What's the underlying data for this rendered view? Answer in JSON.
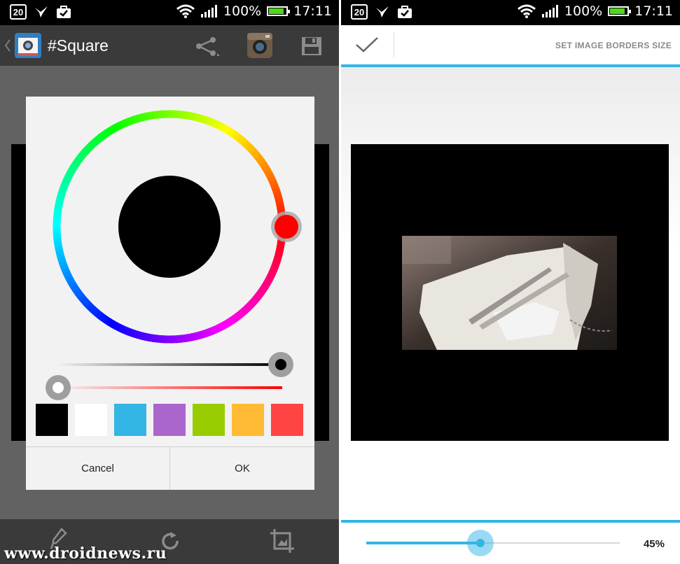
{
  "status_bar": {
    "calendar_day": "20",
    "battery_percent": "100%",
    "time": "17:11"
  },
  "left_screen": {
    "app_title": "#Square",
    "icons": [
      "share-icon",
      "instagram-icon",
      "save-icon",
      "eyedropper-icon",
      "rotate-icon",
      "crop-icon"
    ],
    "color_picker": {
      "selected_color": "#000000",
      "hue_handle_color": "#ff0000",
      "value_level": 1.0,
      "saturation_level": 0.0,
      "swatches": [
        "#000000",
        "#ffffff",
        "#33b5e5",
        "#aa66cc",
        "#99cc00",
        "#ffbb33",
        "#ff4444"
      ],
      "cancel_label": "Cancel",
      "ok_label": "OK"
    },
    "watermark": "www.droidnews.ru"
  },
  "right_screen": {
    "action_title": "SET IMAGE BORDERS SIZE",
    "border_size_percent": "45%",
    "border_size_value": 0.45,
    "accent_color": "#33b5e5"
  }
}
